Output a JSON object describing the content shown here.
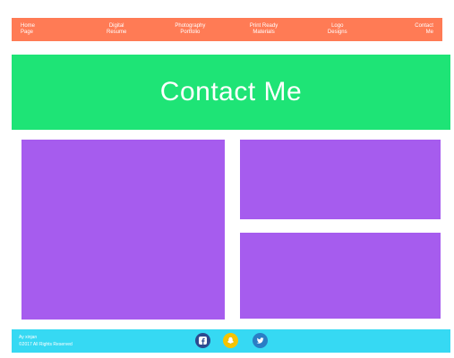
{
  "colors": {
    "nav_bg": "#ff7b55",
    "hero_bg": "#1ee476",
    "panel_bg": "#a65cee",
    "footer_bg": "#36d9f3",
    "facebook": "#2d4a8f",
    "snapchat": "#f5c400",
    "twitter": "#2a7dc5"
  },
  "nav": {
    "items": [
      {
        "label": "Home\nPage"
      },
      {
        "label": "Digital\nResume"
      },
      {
        "label": "Photography\nPortfolio"
      },
      {
        "label": "Print Ready\nMaterials"
      },
      {
        "label": "Logo\nDesigns"
      },
      {
        "label": "Contact\nMe"
      }
    ]
  },
  "hero": {
    "title": "Contact Me"
  },
  "footer": {
    "line1": "Ay xinjan",
    "line2": "©2017 All Rights Reserved",
    "social": [
      {
        "icon": "facebook-icon"
      },
      {
        "icon": "snapchat-icon"
      },
      {
        "icon": "twitter-icon"
      }
    ]
  }
}
